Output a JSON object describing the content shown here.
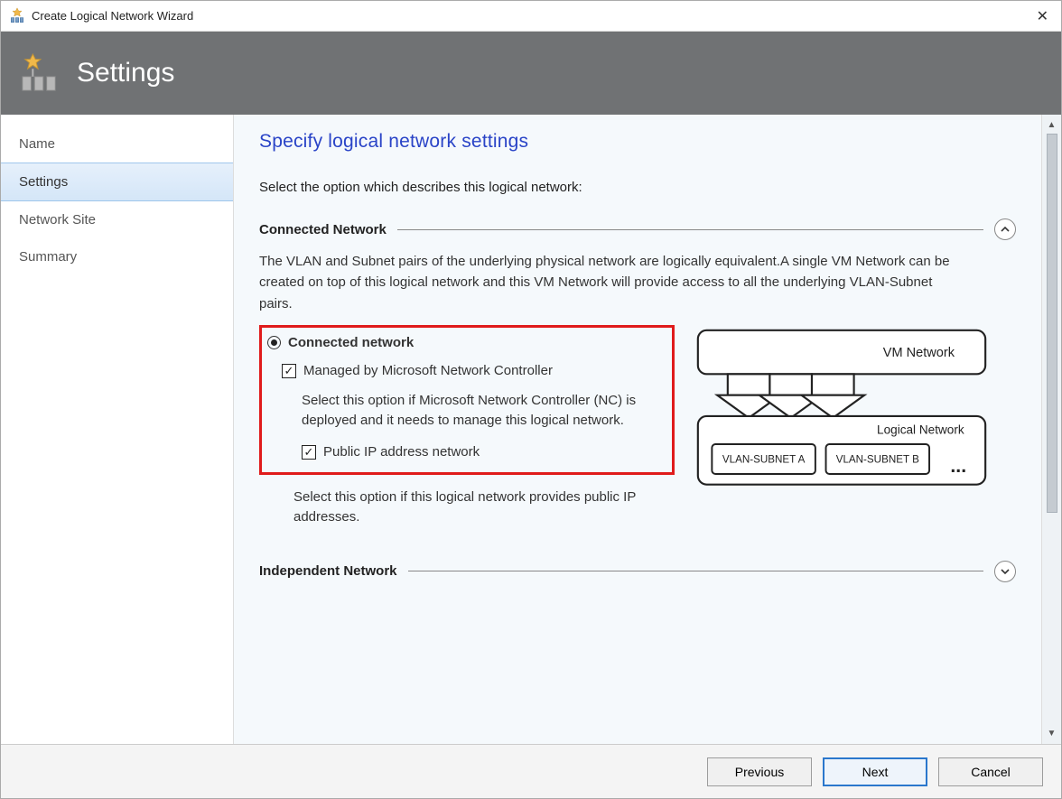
{
  "window": {
    "title": "Create Logical Network Wizard"
  },
  "banner": {
    "title": "Settings"
  },
  "sidebar": {
    "items": [
      {
        "label": "Name",
        "selected": false
      },
      {
        "label": "Settings",
        "selected": true
      },
      {
        "label": "Network Site",
        "selected": false
      },
      {
        "label": "Summary",
        "selected": false
      }
    ]
  },
  "content": {
    "heading": "Specify logical network settings",
    "instruction": "Select the option which describes this logical network:",
    "sections": {
      "connected": {
        "title": "Connected Network",
        "expanded": true,
        "desc": "The VLAN and Subnet pairs of the underlying physical network are logically equivalent.A single VM Network can be created on top of this logical network and this VM Network will provide access to all the underlying VLAN-Subnet pairs.",
        "radio_label": "Connected network",
        "radio_selected": true,
        "chk_managed_label": "Managed by Microsoft Network Controller",
        "chk_managed_checked": true,
        "chk_managed_desc": "Select this option if Microsoft Network Controller (NC) is deployed and it needs to manage this logical network.",
        "chk_public_label": "Public IP address network",
        "chk_public_checked": true,
        "chk_public_desc": "Select this option if this logical network provides public IP addresses."
      },
      "independent": {
        "title": "Independent Network",
        "expanded": false
      }
    },
    "diagram": {
      "vm_label": "VM Network",
      "logical_label": "Logical  Network",
      "vlan_a": "VLAN-SUBNET A",
      "vlan_b": "VLAN-SUBNET B",
      "ellipsis": "..."
    }
  },
  "footer": {
    "previous": "Previous",
    "next": "Next",
    "cancel": "Cancel"
  }
}
